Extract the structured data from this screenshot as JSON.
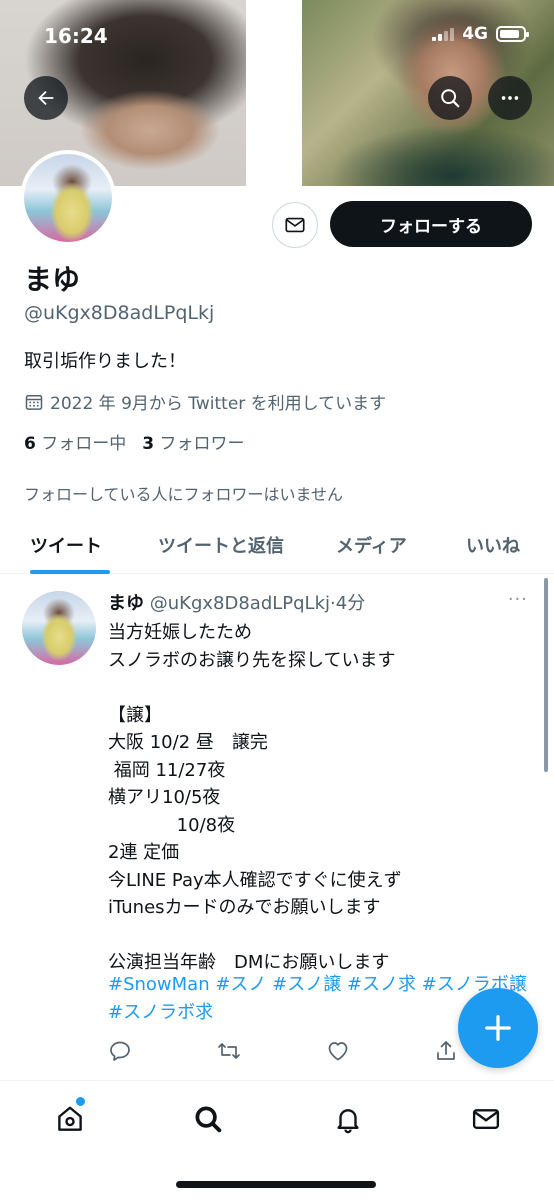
{
  "status_bar": {
    "time": "16:24",
    "network": "4G",
    "battery_level": 0.85
  },
  "profile": {
    "display_name": "まゆ",
    "handle": "@uKgx8D8adLPqLkj",
    "bio": "取引垢作りました！",
    "joined": "2022 年 9月から Twitter を利用しています",
    "following_count": "6",
    "following_label": "フォロー中",
    "followers_count": "3",
    "followers_label": "フォロワー",
    "followers_note": "フォローしている人にフォロワーはいません",
    "follow_button": "フォローする"
  },
  "icons": {
    "back": "arrow-left-icon",
    "search": "search-icon",
    "more": "more-horizontal-icon",
    "message": "envelope-icon",
    "calendar": "calendar-icon",
    "reply": "reply-icon",
    "retweet": "retweet-icon",
    "like": "heart-icon",
    "share": "share-icon",
    "compose": "plus-icon",
    "nav_home": "home-icon",
    "nav_search": "search-icon",
    "nav_notifications": "bell-icon",
    "nav_messages": "envelope-icon"
  },
  "tabs": [
    {
      "label": "ツイート",
      "active": true
    },
    {
      "label": "ツイートと返信",
      "active": false
    },
    {
      "label": "メディア",
      "active": false
    },
    {
      "label": "いいね",
      "active": false
    }
  ],
  "tweet": {
    "name": "まゆ",
    "handle": "@uKgx8D8adLPqLkj",
    "separator": "·",
    "time": "4分",
    "more": "···",
    "body": "当方妊娠したため\nスノラボのお譲り先を探しています\n\n【譲】\n大阪 10/2 昼　譲完\n 福岡 11/27夜\n横アリ10/5夜\n            10/8夜\n2連 定価\n今LINE Pay本人確認ですぐに使えず\niTunesカードのみでお願いします\n\n公演担当年齢　DMにお願いします",
    "hashtags": "#SnowMan #スノ #スノ譲 #スノ求 #スノラボ譲 #スノラボ求"
  },
  "colors": {
    "accent": "#1d9bf0",
    "text_primary": "#0f1419",
    "text_secondary": "#536471",
    "follow_button_bg": "#0f1419"
  }
}
